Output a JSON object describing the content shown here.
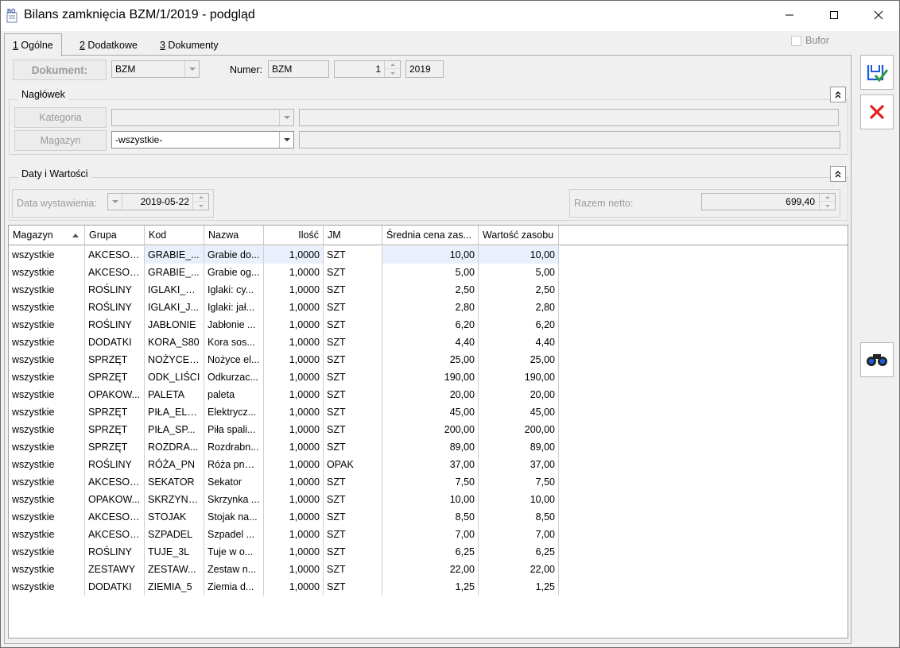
{
  "window": {
    "title": "Bilans zamknięcia BZM/1/2019 - podgląd"
  },
  "tabs": [
    {
      "hotkey": "1",
      "label": " Ogólne"
    },
    {
      "hotkey": "2",
      "label": " Dodatkowe"
    },
    {
      "hotkey": "3",
      "label": " Dokumenty"
    }
  ],
  "bufor": {
    "label": "Bufor",
    "checked": false
  },
  "document": {
    "button_label": "Dokument:",
    "type_value": "BZM",
    "number_label": "Numer:",
    "number_prefix": "BZM",
    "number_seq": "1",
    "number_year": "2019"
  },
  "header_section": {
    "title": "Nagłówek",
    "category_button": "Kategoria",
    "category_value": "",
    "category_description": "",
    "warehouse_button": "Magazyn",
    "warehouse_value": "-wszystkie-",
    "warehouse_description": ""
  },
  "dates_section": {
    "title": "Daty i Wartości",
    "issue_date_label": "Data wystawienia:",
    "issue_date_value": "2019-05-22",
    "net_total_label": "Razem netto:",
    "net_total_value": "699,40"
  },
  "table": {
    "columns": [
      "Magazyn",
      "Grupa",
      "Kod",
      "Nazwa",
      "Ilość",
      "JM",
      "Średnia cena zas...",
      "Wartość zasobu"
    ],
    "rows": [
      [
        "wszystkie",
        "AKCESORIA",
        "GRABIE_...",
        "Grabie do...",
        "1,0000",
        "SZT",
        "10,00",
        "10,00"
      ],
      [
        "wszystkie",
        "AKCESORIA",
        "GRABIE_...",
        "Grabie og...",
        "1,0000",
        "SZT",
        "5,00",
        "5,00"
      ],
      [
        "wszystkie",
        "ROŚLINY",
        "IGLAKI_C...",
        "Iglaki: cy...",
        "1,0000",
        "SZT",
        "2,50",
        "2,50"
      ],
      [
        "wszystkie",
        "ROŚLINY",
        "IGLAKI_J...",
        "Iglaki: jał...",
        "1,0000",
        "SZT",
        "2,80",
        "2,80"
      ],
      [
        "wszystkie",
        "ROŚLINY",
        "JABŁONIE",
        "Jabłonie ...",
        "1,0000",
        "SZT",
        "6,20",
        "6,20"
      ],
      [
        "wszystkie",
        "DODATKI",
        "KORA_S80",
        "Kora sos...",
        "1,0000",
        "SZT",
        "4,40",
        "4,40"
      ],
      [
        "wszystkie",
        "SPRZĘT",
        "NOŻYCE_...",
        "Nożyce el...",
        "1,0000",
        "SZT",
        "25,00",
        "25,00"
      ],
      [
        "wszystkie",
        "SPRZĘT",
        "ODK_LIŚCI",
        "Odkurzac...",
        "1,0000",
        "SZT",
        "190,00",
        "190,00"
      ],
      [
        "wszystkie",
        "OPAKOW...",
        "PALETA",
        "paleta",
        "1,0000",
        "SZT",
        "20,00",
        "20,00"
      ],
      [
        "wszystkie",
        "SPRZĘT",
        "PIŁA_ELE...",
        "Elektrycz...",
        "1,0000",
        "SZT",
        "45,00",
        "45,00"
      ],
      [
        "wszystkie",
        "SPRZĘT",
        "PIŁA_SP...",
        "Piła spali...",
        "1,0000",
        "SZT",
        "200,00",
        "200,00"
      ],
      [
        "wszystkie",
        "SPRZĘT",
        "ROZDRA...",
        "Rozdrabn...",
        "1,0000",
        "SZT",
        "89,00",
        "89,00"
      ],
      [
        "wszystkie",
        "ROŚLINY",
        "RÓŻA_PN",
        "Róża pnąca",
        "1,0000",
        "OPAK",
        "37,00",
        "37,00"
      ],
      [
        "wszystkie",
        "AKCESORIA",
        "SEKATOR",
        "Sekator",
        "1,0000",
        "SZT",
        "7,50",
        "7,50"
      ],
      [
        "wszystkie",
        "OPAKOW...",
        "SKRZYNKA",
        "Skrzynka ...",
        "1,0000",
        "SZT",
        "10,00",
        "10,00"
      ],
      [
        "wszystkie",
        "AKCESORIA",
        "STOJAK",
        "Stojak na...",
        "1,0000",
        "SZT",
        "8,50",
        "8,50"
      ],
      [
        "wszystkie",
        "AKCESORIA",
        "SZPADEL",
        "Szpadel ...",
        "1,0000",
        "SZT",
        "7,00",
        "7,00"
      ],
      [
        "wszystkie",
        "ROŚLINY",
        "TUJE_3L",
        "Tuje w o...",
        "1,0000",
        "SZT",
        "6,25",
        "6,25"
      ],
      [
        "wszystkie",
        "ZESTAWY",
        "ZESTAW...",
        "Zestaw n...",
        "1,0000",
        "SZT",
        "22,00",
        "22,00"
      ],
      [
        "wszystkie",
        "DODATKI",
        "ZIEMIA_5",
        "Ziemia d...",
        "1,0000",
        "SZT",
        "1,25",
        "1,25"
      ]
    ]
  },
  "colors": {
    "accent_blue": "#1e5bd8",
    "cancel_red": "#e02020",
    "selected_row": "#eaf0fb"
  },
  "icons": {
    "save": "save-check-icon",
    "cancel": "cancel-x-icon",
    "search": "binoculars-icon"
  }
}
